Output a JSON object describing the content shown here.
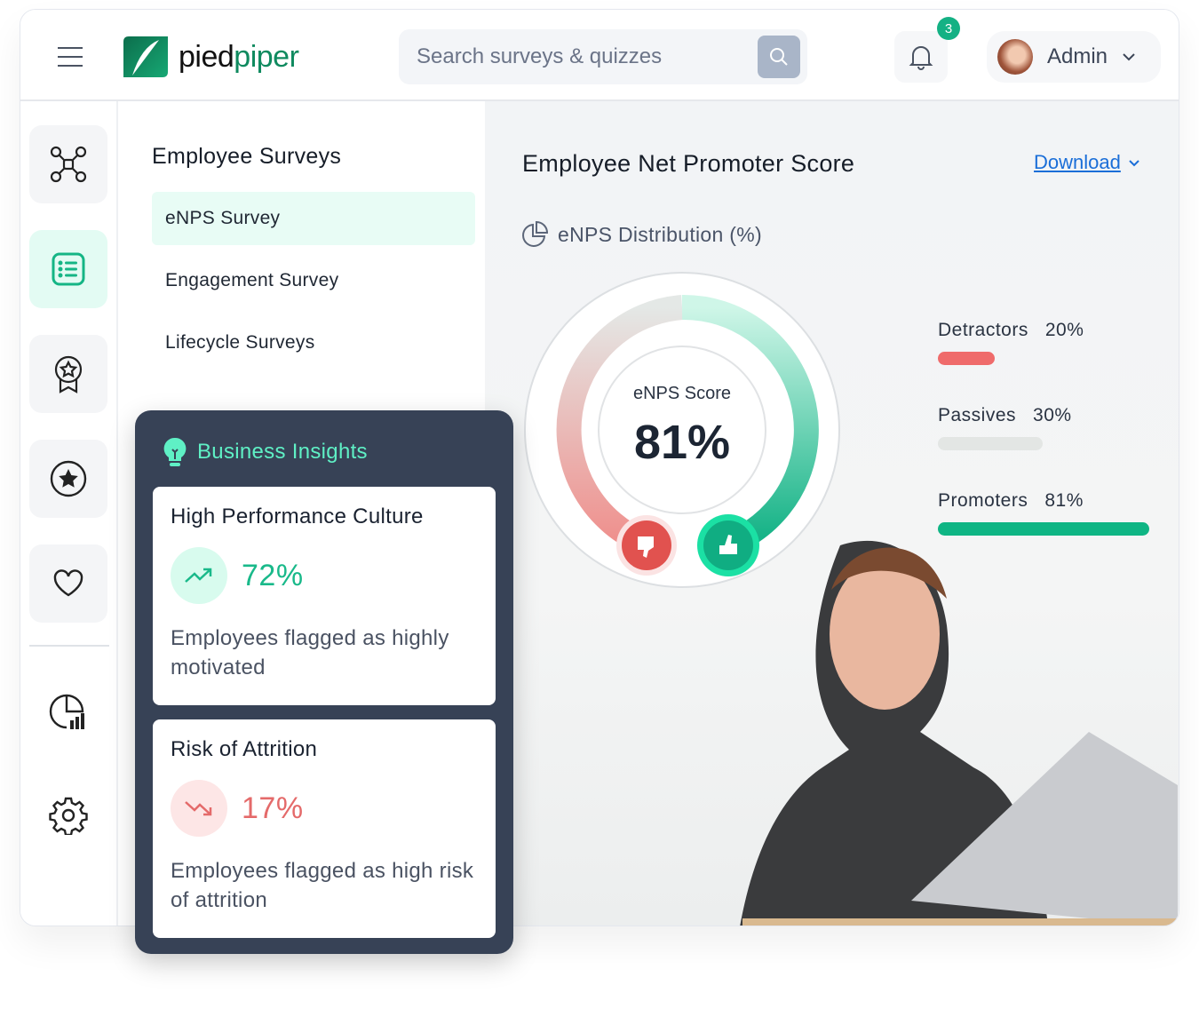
{
  "header": {
    "brand": {
      "part1": "pied",
      "part2": "piper"
    },
    "search": {
      "placeholder": "Search surveys & quizzes"
    },
    "notifications": {
      "count": "3"
    },
    "user": {
      "name": "Admin"
    }
  },
  "rail": {
    "icons": [
      "network-icon",
      "survey-list-icon",
      "award-badge-icon",
      "star-circle-icon",
      "heart-icon",
      "analytics-icon",
      "settings-icon"
    ]
  },
  "submenu": {
    "title": "Employee Surveys",
    "items": [
      {
        "label": "eNPS Survey",
        "active": true
      },
      {
        "label": "Engagement Survey"
      },
      {
        "label": "Lifecycle Surveys"
      }
    ]
  },
  "main": {
    "title": "Employee Net Promoter Score",
    "download_label": "Download",
    "distribution_label": "eNPS Distribution (%)",
    "gauge": {
      "label": "eNPS Score",
      "value": "81%"
    },
    "legend": [
      {
        "name": "Detractors",
        "value": "20%",
        "fraction": 0.2,
        "color": "#ef6b6b"
      },
      {
        "name": "Passives",
        "value": "30%",
        "fraction": 0.3,
        "color": "#e3e6e4"
      },
      {
        "name": "Promoters",
        "value": "81%",
        "fraction": 0.81,
        "color": "#0fb584"
      }
    ]
  },
  "insights": {
    "title": "Business Insights",
    "cards": [
      {
        "title": "High Performance Culture",
        "value": "72%",
        "description": "Employees flagged as highly motivated",
        "trend": "up",
        "color": "#19b98a"
      },
      {
        "title": "Risk of Attrition",
        "value": "17%",
        "description": "Employees flagged as high risk of attrition",
        "trend": "down",
        "color": "#e46a6a"
      }
    ]
  }
}
